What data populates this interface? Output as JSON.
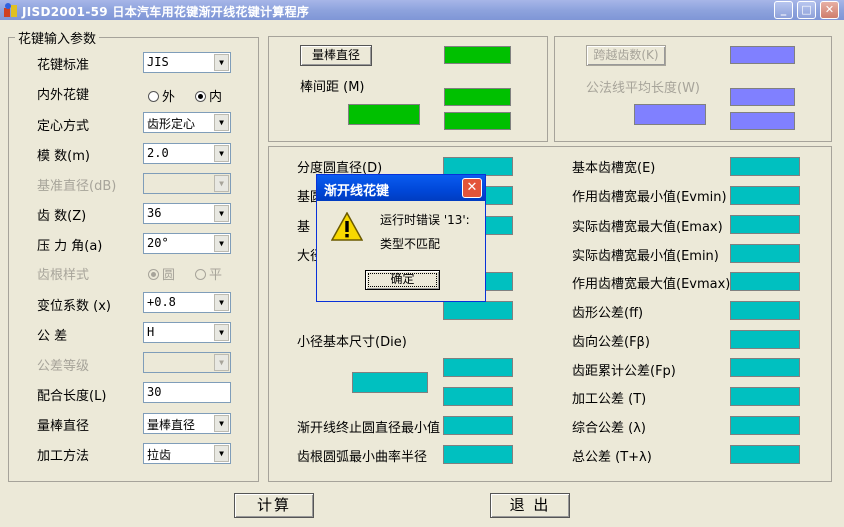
{
  "window": {
    "title": "JISD2001-59 日本汽车用花键渐开线花键计算程序",
    "colors": {
      "green": "#00c000",
      "teal": "#00c0c0",
      "blue": "#8080ff",
      "titlebar": "#8ea3dd"
    }
  },
  "input_group": {
    "legend": "花键输入参数",
    "fields": {
      "standard": {
        "label": "花键标准",
        "value": "JIS"
      },
      "inner_outer": {
        "label": "内外花键",
        "opt_outer": "外",
        "opt_inner": "内",
        "selected": "内"
      },
      "centering": {
        "label": "定心方式",
        "value": "齿形定心"
      },
      "module": {
        "label": "模    数(m)",
        "value": "2.0"
      },
      "base_dia": {
        "label": "基准直径(dB)",
        "value": ""
      },
      "teeth": {
        "label": "齿    数(Z)",
        "value": "36"
      },
      "pressure_angle": {
        "label": "压 力 角(a)",
        "value": "20°"
      },
      "root_style": {
        "label": "齿根样式",
        "opt_round": "圆",
        "opt_flat": "平",
        "selected": "圆"
      },
      "shift_coef": {
        "label": "变位系数 (x)",
        "value": "+0.8"
      },
      "tolerance": {
        "label": "公    差",
        "value": "H"
      },
      "tol_grade": {
        "label": "公差等级",
        "value": ""
      },
      "fit_length": {
        "label": "配合长度(L)",
        "value": "30"
      },
      "rod_dia": {
        "label": "量棒直径",
        "value": "量棒直径"
      },
      "process": {
        "label": "加工方法",
        "value": "拉齿"
      }
    }
  },
  "measure_panel": {
    "rod_button": "量棒直径",
    "rod_distance_label": "棒间距 (M)"
  },
  "span_panel": {
    "span_teeth_button": "跨越齿数(K)",
    "span_length_label": "公法线平均长度(W)"
  },
  "results": {
    "left": {
      "pitch_dia": "分度圆直径(D)",
      "base_dia_partial": "基圆",
      "base_partial2": "基",
      "major_partial": "大径",
      "minor_dia": "小径基本尺寸(Die)",
      "involute_end": "渐开线终止圆直径最小值",
      "root_fillet": "齿根圆弧最小曲率半径"
    },
    "right": {
      "basic_space": "基本齿槽宽(E)",
      "eff_space_min": "作用齿槽宽最小值(Evmin)",
      "act_space_max": "实际齿槽宽最大值(Emax)",
      "act_space_min": "实际齿槽宽最小值(Emin)",
      "eff_space_max": "作用齿槽宽最大值(Evmax)",
      "profile_tol": "齿形公差(ff)",
      "lead_tol": "齿向公差(Fβ)",
      "pitch_cum_tol": "齿距累计公差(Fp)",
      "machining_tol": "加工公差 (T)",
      "total_tol": "综合公差 (λ)",
      "grand_tol": "总公差 (T+λ)"
    }
  },
  "buttons": {
    "calc": "计算",
    "exit": "退 出"
  },
  "dialog": {
    "title": "渐开线花键",
    "message_line1": "运行时错误 '13':",
    "message_line2": "类型不匹配",
    "ok": "确定"
  }
}
